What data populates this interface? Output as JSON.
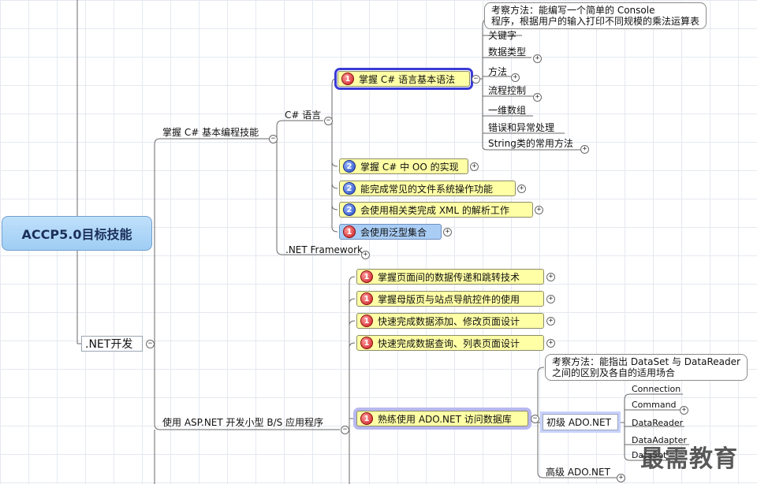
{
  "root": {
    "label": "ACCP5.0目标技能"
  },
  "branches": {
    "dotnet_dev": ".NET开发",
    "csharp_basic_skill": "掌握 C# 基本编程技能",
    "csharp_language": "C# 语言",
    "net_framework": ".NET Framework",
    "aspnet_bs": "使用 ASP.NET 开发小型 B/S 应用程序"
  },
  "csharp_nodes": [
    {
      "priority": "1",
      "label": "掌握 C# 语言基本语法"
    },
    {
      "priority": "2",
      "label": "掌握 C# 中 OO 的实现"
    },
    {
      "priority": "2",
      "label": "能完成常见的文件系统操作功能"
    },
    {
      "priority": "2",
      "label": "会使用相关类完成 XML 的解析工作"
    },
    {
      "priority": "1",
      "label": "会使用泛型集合"
    }
  ],
  "syntax_callout": {
    "line1": "考察方法：能编写一个简单的 Console",
    "line2": "程序，根据用户的输入打印不同规模的乘法运算表"
  },
  "syntax_children": [
    "关键字",
    "数据类型",
    "方法",
    "流程控制",
    "一维数组",
    "错误和异常处理",
    "String类的常用方法"
  ],
  "aspnet_nodes": [
    {
      "priority": "1",
      "label": "掌握页面间的数据传递和跳转技术"
    },
    {
      "priority": "1",
      "label": "掌握母版页与站点导航控件的使用"
    },
    {
      "priority": "1",
      "label": "快速完成数据添加、修改页面设计"
    },
    {
      "priority": "1",
      "label": "快速完成数据查询、列表页面设计"
    },
    {
      "priority": "1",
      "label": "熟练使用 ADO.NET 访问数据库"
    }
  ],
  "ado_callout": {
    "line1": "考察方法：能指出 DataSet 与 DataReader",
    "line2": "之间的区别及各自的适用场合"
  },
  "ado_levels": {
    "basic": "初级 ADO.NET",
    "advanced": "高级 ADO.NET"
  },
  "basic_children": [
    "Connection",
    "Command",
    "DataReader",
    "DataAdapter",
    "DataSet"
  ],
  "toggles": {
    "plus": "+",
    "minus": "−"
  },
  "watermark": "最需教育",
  "colors": {
    "node_yellow": "#ffffa6",
    "node_blue": "#a9cdf5",
    "root_blue": "#9fcdf4",
    "selection": "#3b3bd6"
  }
}
